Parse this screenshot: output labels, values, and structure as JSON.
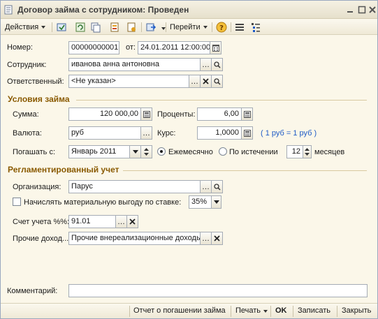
{
  "window": {
    "title": "Договор займа с сотрудником: Проведен"
  },
  "toolbar": {
    "actions_label": "Действия",
    "goto_label": "Перейти"
  },
  "header": {
    "number_label": "Номер:",
    "number_value": "00000000001",
    "date_prefix": "от:",
    "date_value": "24.01.2011 12:00:00",
    "employee_label": "Сотрудник:",
    "employee_value": "иванова анна антоновна",
    "responsible_label": "Ответственный:",
    "responsible_value": "<Не указан>"
  },
  "loan_terms": {
    "section_title": "Условия займа",
    "amount_label": "Сумма:",
    "amount_value": "120 000,00",
    "percent_label": "Проценты:",
    "percent_value": "6,00",
    "currency_label": "Валюта:",
    "currency_value": "руб",
    "rate_label": "Курс:",
    "rate_value": "1,0000",
    "rate_hint": "( 1 руб = 1 руб )",
    "repay_label": "Погашать с:",
    "repay_value": "Январь 2011",
    "monthly_label": "Ежемесячно",
    "at_end_label": "По истечении",
    "months_value": "12",
    "months_label": "месяцев",
    "repay_mode": "monthly"
  },
  "accounting": {
    "section_title": "Регламентированный учет",
    "org_label": "Организация:",
    "org_value": "Парус",
    "benefit_label": "Начислять материальную выгоду по ставке:",
    "benefit_checked": false,
    "benefit_rate": "35%",
    "account_label": "Счет учета %%:",
    "account_value": "91.01",
    "other_income_label": "Прочие доход...",
    "other_income_value": "Прочие внереализационные доходы"
  },
  "comment": {
    "label": "Комментарий:",
    "value": ""
  },
  "footer": {
    "report_label": "Отчет о погашении займа",
    "print_label": "Печать",
    "ok_label": "OK",
    "save_label": "Записать",
    "close_label": "Закрыть"
  },
  "colors": {
    "background": "#fbf7e9",
    "section_title": "#8a5a00",
    "hint": "#1e5bc6"
  }
}
